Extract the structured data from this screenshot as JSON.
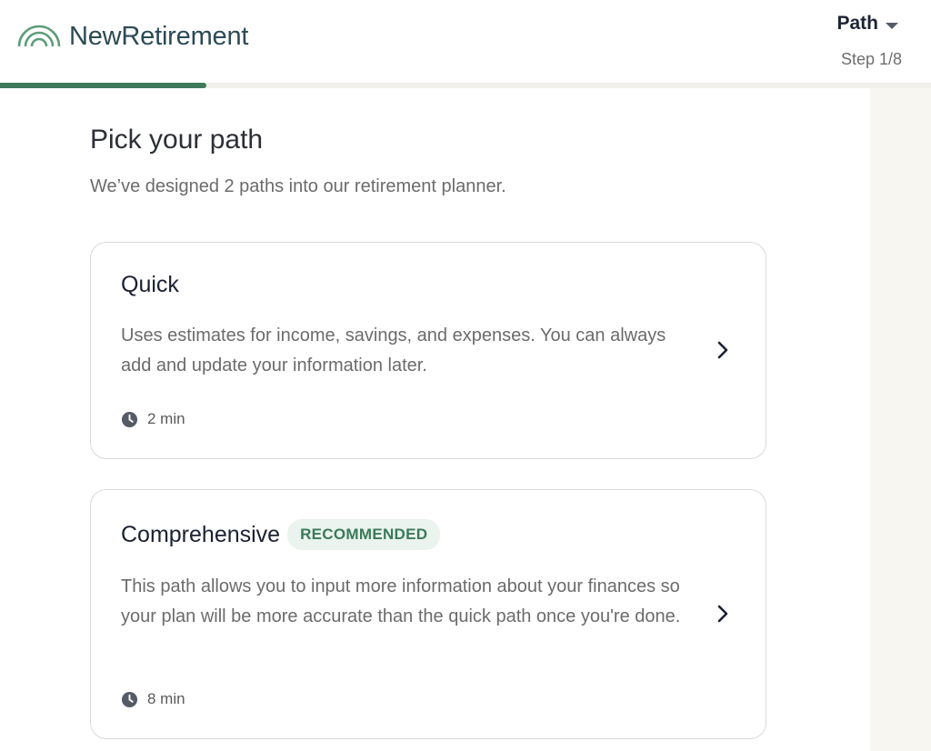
{
  "header": {
    "logo_text": "NewRetirement",
    "path_label": "Path",
    "step_text": "Step 1/8",
    "progress_fraction": 0.222
  },
  "main": {
    "title": "Pick your path",
    "subtitle": "We’ve designed 2 paths into our retirement planner."
  },
  "cards": [
    {
      "title": "Quick",
      "description": "Uses estimates for income, savings, and expenses. You can always add and update your information later.",
      "time": "2 min"
    },
    {
      "title": "Comprehensive",
      "badge": "RECOMMENDED",
      "description": "This path allows you to input more information about your finances so your plan will be more accurate than the quick path once you're done.",
      "time": "8 min"
    }
  ],
  "colors": {
    "brand_green": "#3d7a5b",
    "logo_text": "#2b4a55",
    "badge_bg": "#eaf3ee",
    "side_panel": "#f8f6f0"
  },
  "icons": {
    "logo": "rainbow-arcs-icon",
    "caret": "caret-down-icon",
    "clock": "clock-icon",
    "chevron": "chevron-right-icon"
  }
}
